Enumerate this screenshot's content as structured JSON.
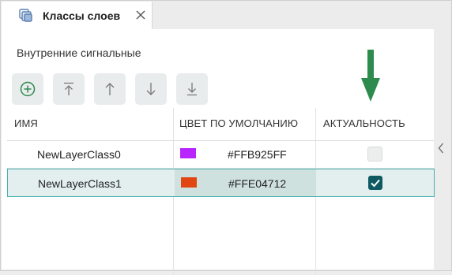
{
  "tab": {
    "title": "Классы слоев",
    "icon": "layers-icon",
    "close_icon": "close-icon"
  },
  "section": {
    "label": "Внутренние сигнальные"
  },
  "toolbar": {
    "buttons": [
      "add-circle-icon",
      "move-top-icon",
      "move-up-icon",
      "move-down-icon",
      "move-bottom-icon"
    ]
  },
  "table": {
    "headers": {
      "name": "ИМЯ",
      "color": "ЦВЕТ ПО УМОЛЧАНИЮ",
      "active": "АКТУАЛЬНОСТЬ"
    },
    "rows": [
      {
        "name": "NewLayerClass0",
        "color_hex": "#FFB925FF",
        "swatch": "#b925ff",
        "active": false,
        "selected": false
      },
      {
        "name": "NewLayerClass1",
        "color_hex": "#FFE04712",
        "swatch": "#e04712",
        "active": true,
        "selected": true
      }
    ]
  },
  "colors": {
    "accent": "#48b0b0",
    "checkbox_on": "#0f5a62",
    "arrow": "#2e8b4e"
  }
}
